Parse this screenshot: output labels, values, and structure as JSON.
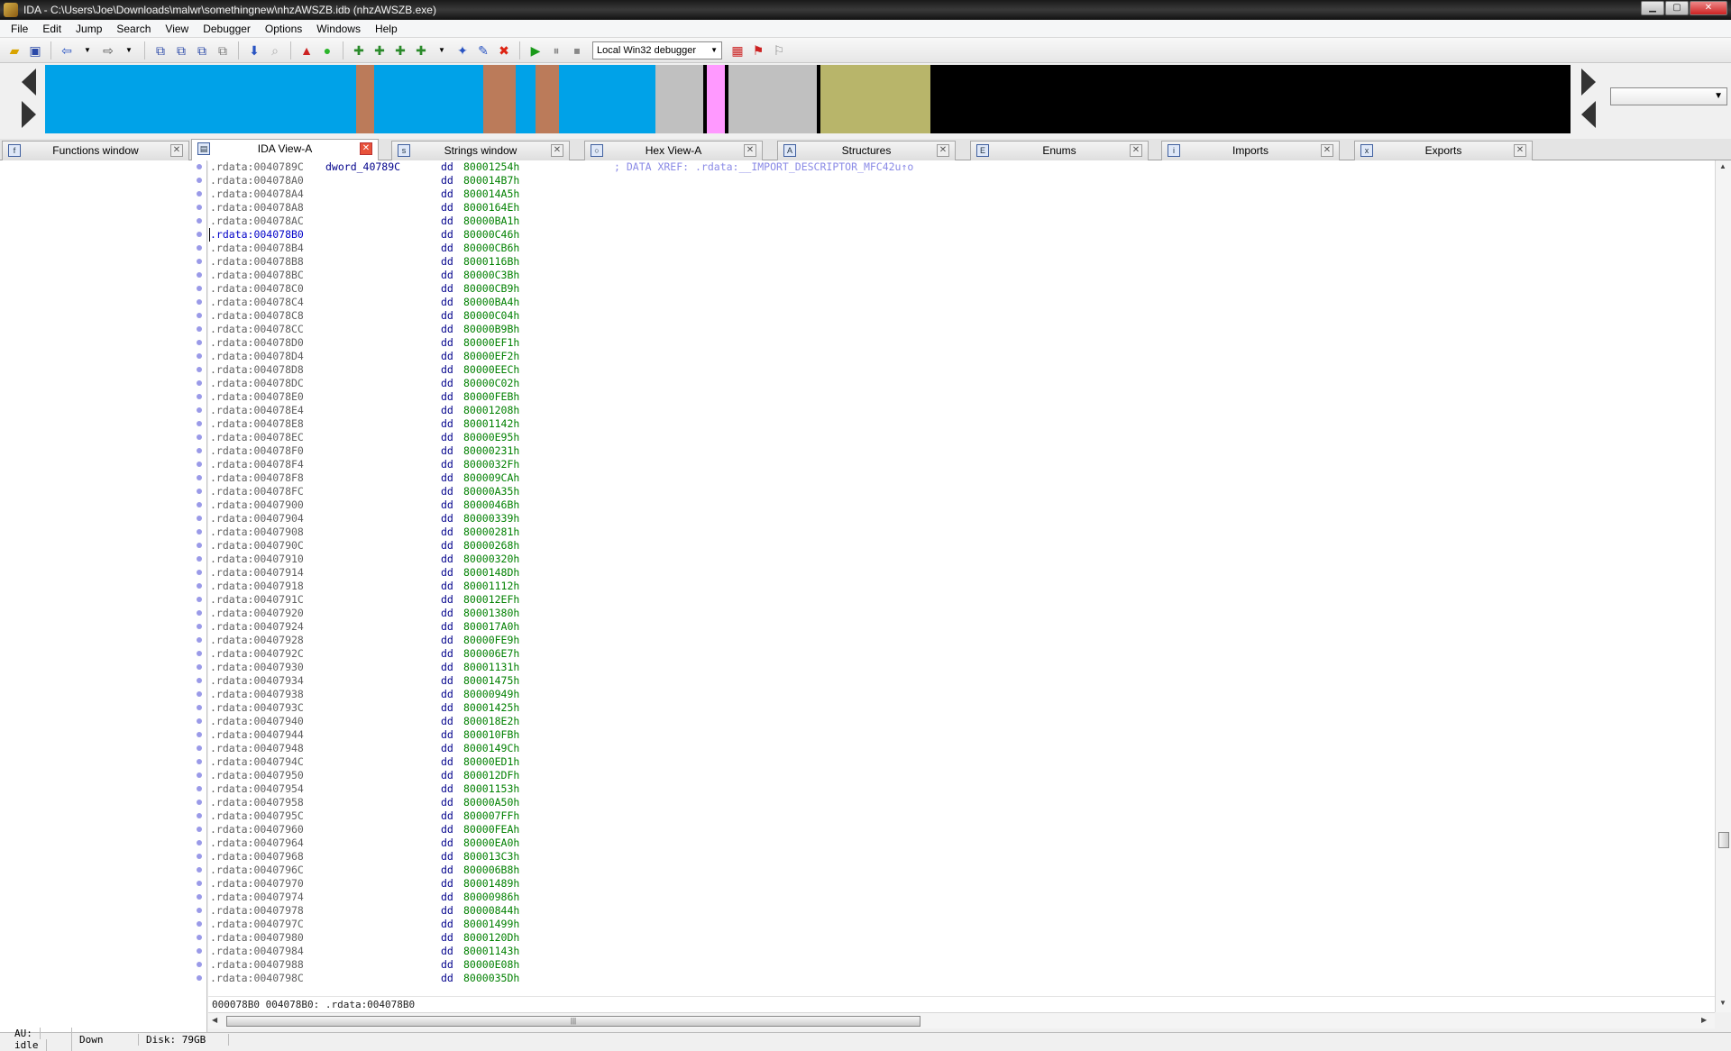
{
  "window": {
    "title": "IDA - C:\\Users\\Joe\\Downloads\\malwr\\somethingnew\\nhzAWSZB.idb (nhzAWSZB.exe)"
  },
  "menu": [
    "File",
    "Edit",
    "Jump",
    "Search",
    "View",
    "Debugger",
    "Options",
    "Windows",
    "Help"
  ],
  "toolbar": {
    "debugger_label": "Local Win32 debugger"
  },
  "tabs": [
    {
      "label": "Functions window",
      "icon": "f"
    },
    {
      "label": "IDA View-A",
      "icon": "▤",
      "active": true
    },
    {
      "label": "Strings window",
      "icon": "s"
    },
    {
      "label": "Hex View-A",
      "icon": "○"
    },
    {
      "label": "Structures",
      "icon": "A"
    },
    {
      "label": "Enums",
      "icon": "E"
    },
    {
      "label": "Imports",
      "icon": "i"
    },
    {
      "label": "Exports",
      "icon": "x"
    }
  ],
  "colors": {
    "nav_code": "#00a2e8",
    "nav_data": "#c0c0c0",
    "nav_func": "#bb7b5a",
    "nav_import": "#ff99ff",
    "nav_unexplored": "#b8b56a",
    "nav_black": "#000000"
  },
  "disasm": {
    "segment": ".rdata",
    "first_label": "dword_40789C",
    "first_comment": "; DATA XREF: .rdata:__IMPORT_DESCRIPTOR_MFC42u↑o",
    "mnemonic": "dd",
    "current_address": ".rdata:004078B0",
    "lines": [
      {
        "addr": "0040789C",
        "val": "80001254h"
      },
      {
        "addr": "004078A0",
        "val": "800014B7h"
      },
      {
        "addr": "004078A4",
        "val": "800014A5h"
      },
      {
        "addr": "004078A8",
        "val": "8000164Eh"
      },
      {
        "addr": "004078AC",
        "val": "80000BA1h"
      },
      {
        "addr": "004078B0",
        "val": "80000C46h"
      },
      {
        "addr": "004078B4",
        "val": "80000CB6h"
      },
      {
        "addr": "004078B8",
        "val": "8000116Bh"
      },
      {
        "addr": "004078BC",
        "val": "80000C3Bh"
      },
      {
        "addr": "004078C0",
        "val": "80000CB9h"
      },
      {
        "addr": "004078C4",
        "val": "80000BA4h"
      },
      {
        "addr": "004078C8",
        "val": "80000C04h"
      },
      {
        "addr": "004078CC",
        "val": "80000B9Bh"
      },
      {
        "addr": "004078D0",
        "val": "80000EF1h"
      },
      {
        "addr": "004078D4",
        "val": "80000EF2h"
      },
      {
        "addr": "004078D8",
        "val": "80000EECh"
      },
      {
        "addr": "004078DC",
        "val": "80000C02h"
      },
      {
        "addr": "004078E0",
        "val": "80000FEBh"
      },
      {
        "addr": "004078E4",
        "val": "80001208h"
      },
      {
        "addr": "004078E8",
        "val": "80001142h"
      },
      {
        "addr": "004078EC",
        "val": "80000E95h"
      },
      {
        "addr": "004078F0",
        "val": "80000231h"
      },
      {
        "addr": "004078F4",
        "val": "8000032Fh"
      },
      {
        "addr": "004078F8",
        "val": "800009CAh"
      },
      {
        "addr": "004078FC",
        "val": "80000A35h"
      },
      {
        "addr": "00407900",
        "val": "8000046Bh"
      },
      {
        "addr": "00407904",
        "val": "80000339h"
      },
      {
        "addr": "00407908",
        "val": "80000281h"
      },
      {
        "addr": "0040790C",
        "val": "80000268h"
      },
      {
        "addr": "00407910",
        "val": "80000320h"
      },
      {
        "addr": "00407914",
        "val": "8000148Dh"
      },
      {
        "addr": "00407918",
        "val": "80001112h"
      },
      {
        "addr": "0040791C",
        "val": "800012EFh"
      },
      {
        "addr": "00407920",
        "val": "80001380h"
      },
      {
        "addr": "00407924",
        "val": "800017A0h"
      },
      {
        "addr": "00407928",
        "val": "80000FE9h"
      },
      {
        "addr": "0040792C",
        "val": "800006E7h"
      },
      {
        "addr": "00407930",
        "val": "80001131h"
      },
      {
        "addr": "00407934",
        "val": "80001475h"
      },
      {
        "addr": "00407938",
        "val": "80000949h"
      },
      {
        "addr": "0040793C",
        "val": "80001425h"
      },
      {
        "addr": "00407940",
        "val": "800018E2h"
      },
      {
        "addr": "00407944",
        "val": "800010FBh"
      },
      {
        "addr": "00407948",
        "val": "8000149Ch"
      },
      {
        "addr": "0040794C",
        "val": "80000ED1h"
      },
      {
        "addr": "00407950",
        "val": "800012DFh"
      },
      {
        "addr": "00407954",
        "val": "80001153h"
      },
      {
        "addr": "00407958",
        "val": "80000A50h"
      },
      {
        "addr": "0040795C",
        "val": "800007FFh"
      },
      {
        "addr": "00407960",
        "val": "80000FEAh"
      },
      {
        "addr": "00407964",
        "val": "80000EA0h"
      },
      {
        "addr": "00407968",
        "val": "800013C3h"
      },
      {
        "addr": "0040796C",
        "val": "800006B8h"
      },
      {
        "addr": "00407970",
        "val": "80001489h"
      },
      {
        "addr": "00407974",
        "val": "80000986h"
      },
      {
        "addr": "00407978",
        "val": "80000844h"
      },
      {
        "addr": "0040797C",
        "val": "80001499h"
      },
      {
        "addr": "00407980",
        "val": "8000120Dh"
      },
      {
        "addr": "00407984",
        "val": "80001143h"
      },
      {
        "addr": "00407988",
        "val": "80000E08h"
      },
      {
        "addr": "0040798C",
        "val": "8000035Dh"
      }
    ]
  },
  "status_line": "000078B0 004078B0: .rdata:004078B0",
  "bottom": {
    "au_label": "AU:",
    "au_state": "idle",
    "direction": "Down",
    "disk": "Disk: 79GB"
  }
}
